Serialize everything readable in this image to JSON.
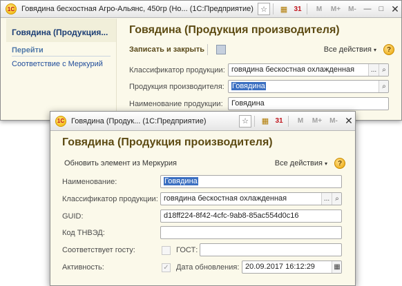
{
  "window1": {
    "title": "Говядина бесхостная Агро-Альянс, 450гр (Но... (1С:Предприятие)",
    "sidebar": {
      "header": "Говядина (Продукция...",
      "section": "Перейти",
      "link": "Соответствие с Меркурий"
    },
    "form_title": "Говядина (Продукция производителя)",
    "save_close_label": "Записать и закрыть",
    "all_actions_label": "Все действия",
    "help_label": "?",
    "fields": {
      "classifier_label": "Классификатор продукции:",
      "classifier_value": "говядина бескостная охлажденная",
      "producer_label": "Продукция производителя:",
      "producer_value": "Говядина",
      "name_label": "Наименование продукции:",
      "name_value": "Говядина"
    }
  },
  "window2": {
    "title": "Говядина (Продук...  (1С:Предприятие)",
    "form_title": "Говядина (Продукция производителя)",
    "update_label": "Обновить элемент из Меркурия",
    "all_actions_label": "Все действия",
    "help_label": "?",
    "fields": {
      "name_label": "Наименование:",
      "name_value": "Говядина",
      "classifier_label": "Классификатор продукции:",
      "classifier_value": "говядина бескостная охлажденная",
      "guid_label": "GUID:",
      "guid_value": "d18ff224-8f42-4cfc-9ab8-85ac554d0c16",
      "tnved_label": "Код ТНВЭД:",
      "tnved_value": "",
      "gost_match_label": "Соответствует госту:",
      "gost_label": "ГОСТ:",
      "gost_value": "",
      "active_label": "Активность:",
      "update_date_label": "Дата обновления:",
      "update_date_value": "20.09.2017 16:12:29"
    }
  },
  "titlebar": {
    "logo_text": "1С",
    "calendar_text": "31",
    "m_label": "M",
    "mplus_label": "M+",
    "mminus_label": "M-",
    "minimize": "—",
    "restore": "□",
    "close": "✕"
  },
  "icons": {
    "dots": "...",
    "search": "⌕",
    "caret": "▾",
    "check": "✓"
  }
}
